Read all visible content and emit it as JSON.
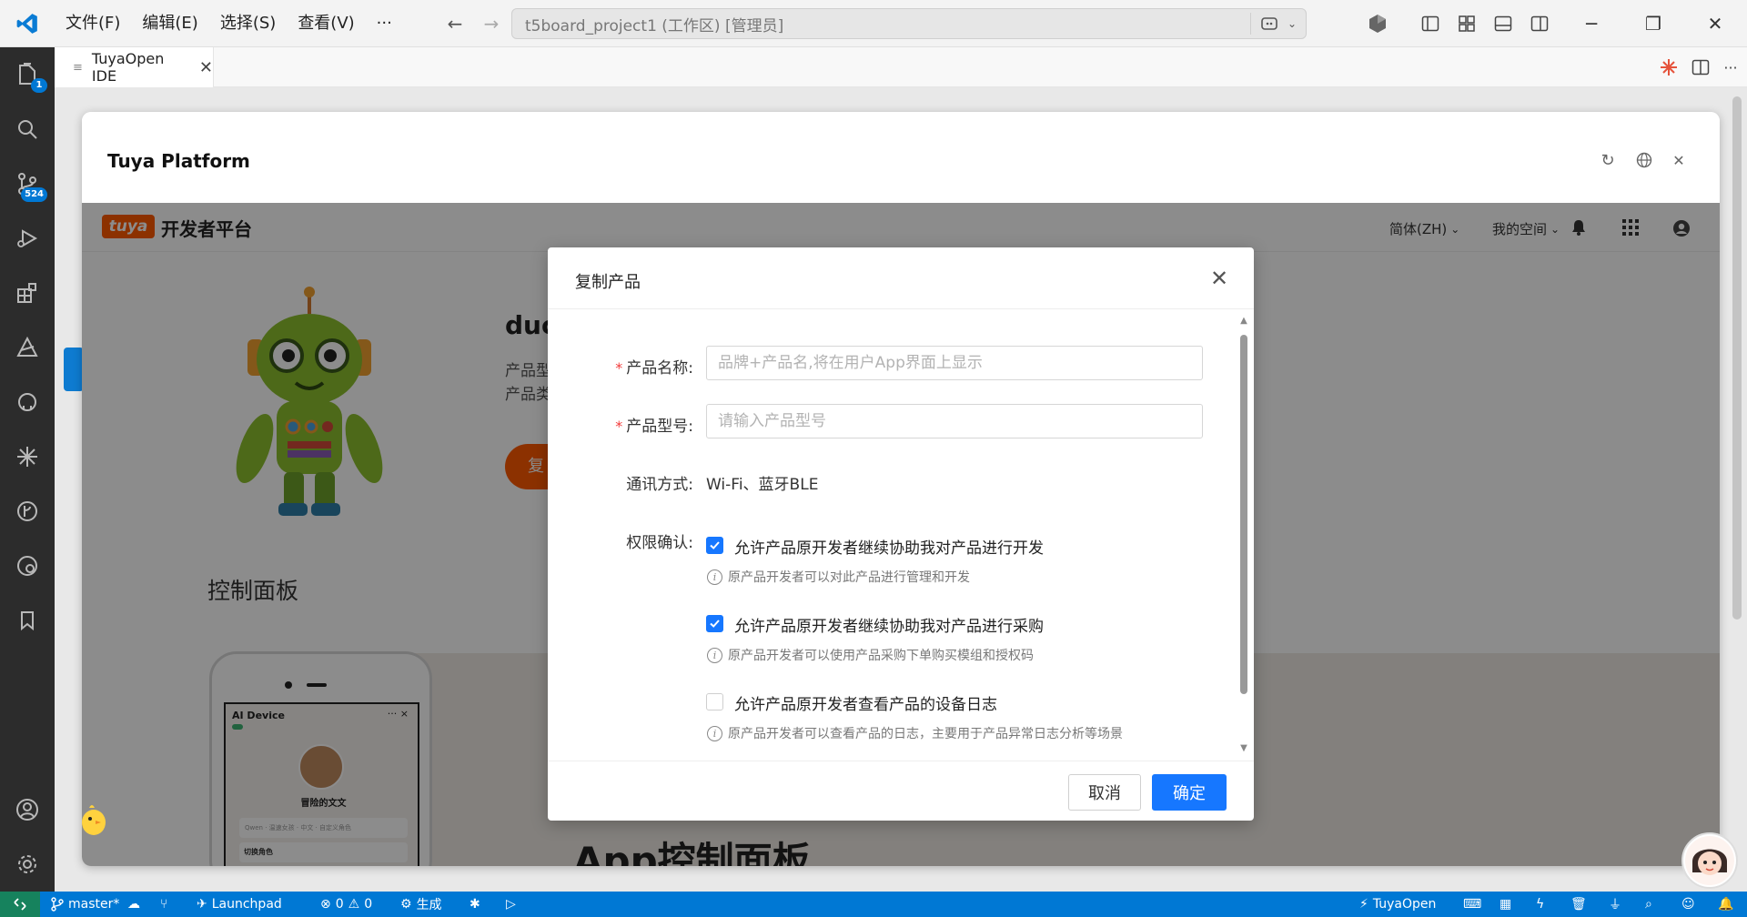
{
  "titlebar": {
    "menus": [
      "文件(F)",
      "编辑(E)",
      "选择(S)",
      "查看(V)",
      "···"
    ],
    "search_text": "t5board_project1 (工作区) [管理员]"
  },
  "activity": {
    "explorer_badge": "1",
    "scm_badge": "524"
  },
  "tab": {
    "label": "TuyaOpen IDE"
  },
  "panel": {
    "title": "Tuya Platform"
  },
  "devbar": {
    "logo": "tuya",
    "platform": "开发者平台",
    "lang": "简体(ZH)",
    "space": "我的空间"
  },
  "page": {
    "product_name": "duc",
    "line1": "产品型",
    "line2": "产品类",
    "copy_btn": "复",
    "control_title": "控制面板",
    "app_title": "App控制面板",
    "phone": {
      "device_title": "AI Device",
      "menu": "···  ×",
      "name": "冒险的文文",
      "meta": "Qwen · 温速女孩 · 中文 · 自定义角色",
      "role": "切换角色"
    }
  },
  "modal": {
    "title": "复制产品",
    "name_label": "产品名称:",
    "name_placeholder": "品牌+产品名,将在用户App界面上显示",
    "model_label": "产品型号:",
    "model_placeholder": "请输入产品型号",
    "comm_label": "通讯方式:",
    "comm_value": "Wi-Fi、蓝牙BLE",
    "perm_label": "权限确认:",
    "perms": [
      {
        "label": "允许产品原开发者继续协助我对产品进行开发",
        "hint": "原产品开发者可以对此产品进行管理和开发",
        "checked": true
      },
      {
        "label": "允许产品原开发者继续协助我对产品进行采购",
        "hint": "原产品开发者可以使用产品采购下单购买模组和授权码",
        "checked": true
      },
      {
        "label": "允许产品原开发者查看产品的设备日志",
        "hint": "原产品开发者可以查看产品的日志，主要用于产品异常日志分析等场景",
        "checked": false
      }
    ],
    "cancel": "取消",
    "ok": "确定"
  },
  "statusbar": {
    "branch": "master*",
    "launchpad": "Launchpad",
    "errors": "0",
    "warnings": "0",
    "build": "生成",
    "tuyaopen": "TuyaOpen"
  },
  "colors": {
    "accent": "#0078d4",
    "tuya_orange": "#ff5a00",
    "primary_btn": "#1677ff",
    "required": "#f23b3b"
  }
}
